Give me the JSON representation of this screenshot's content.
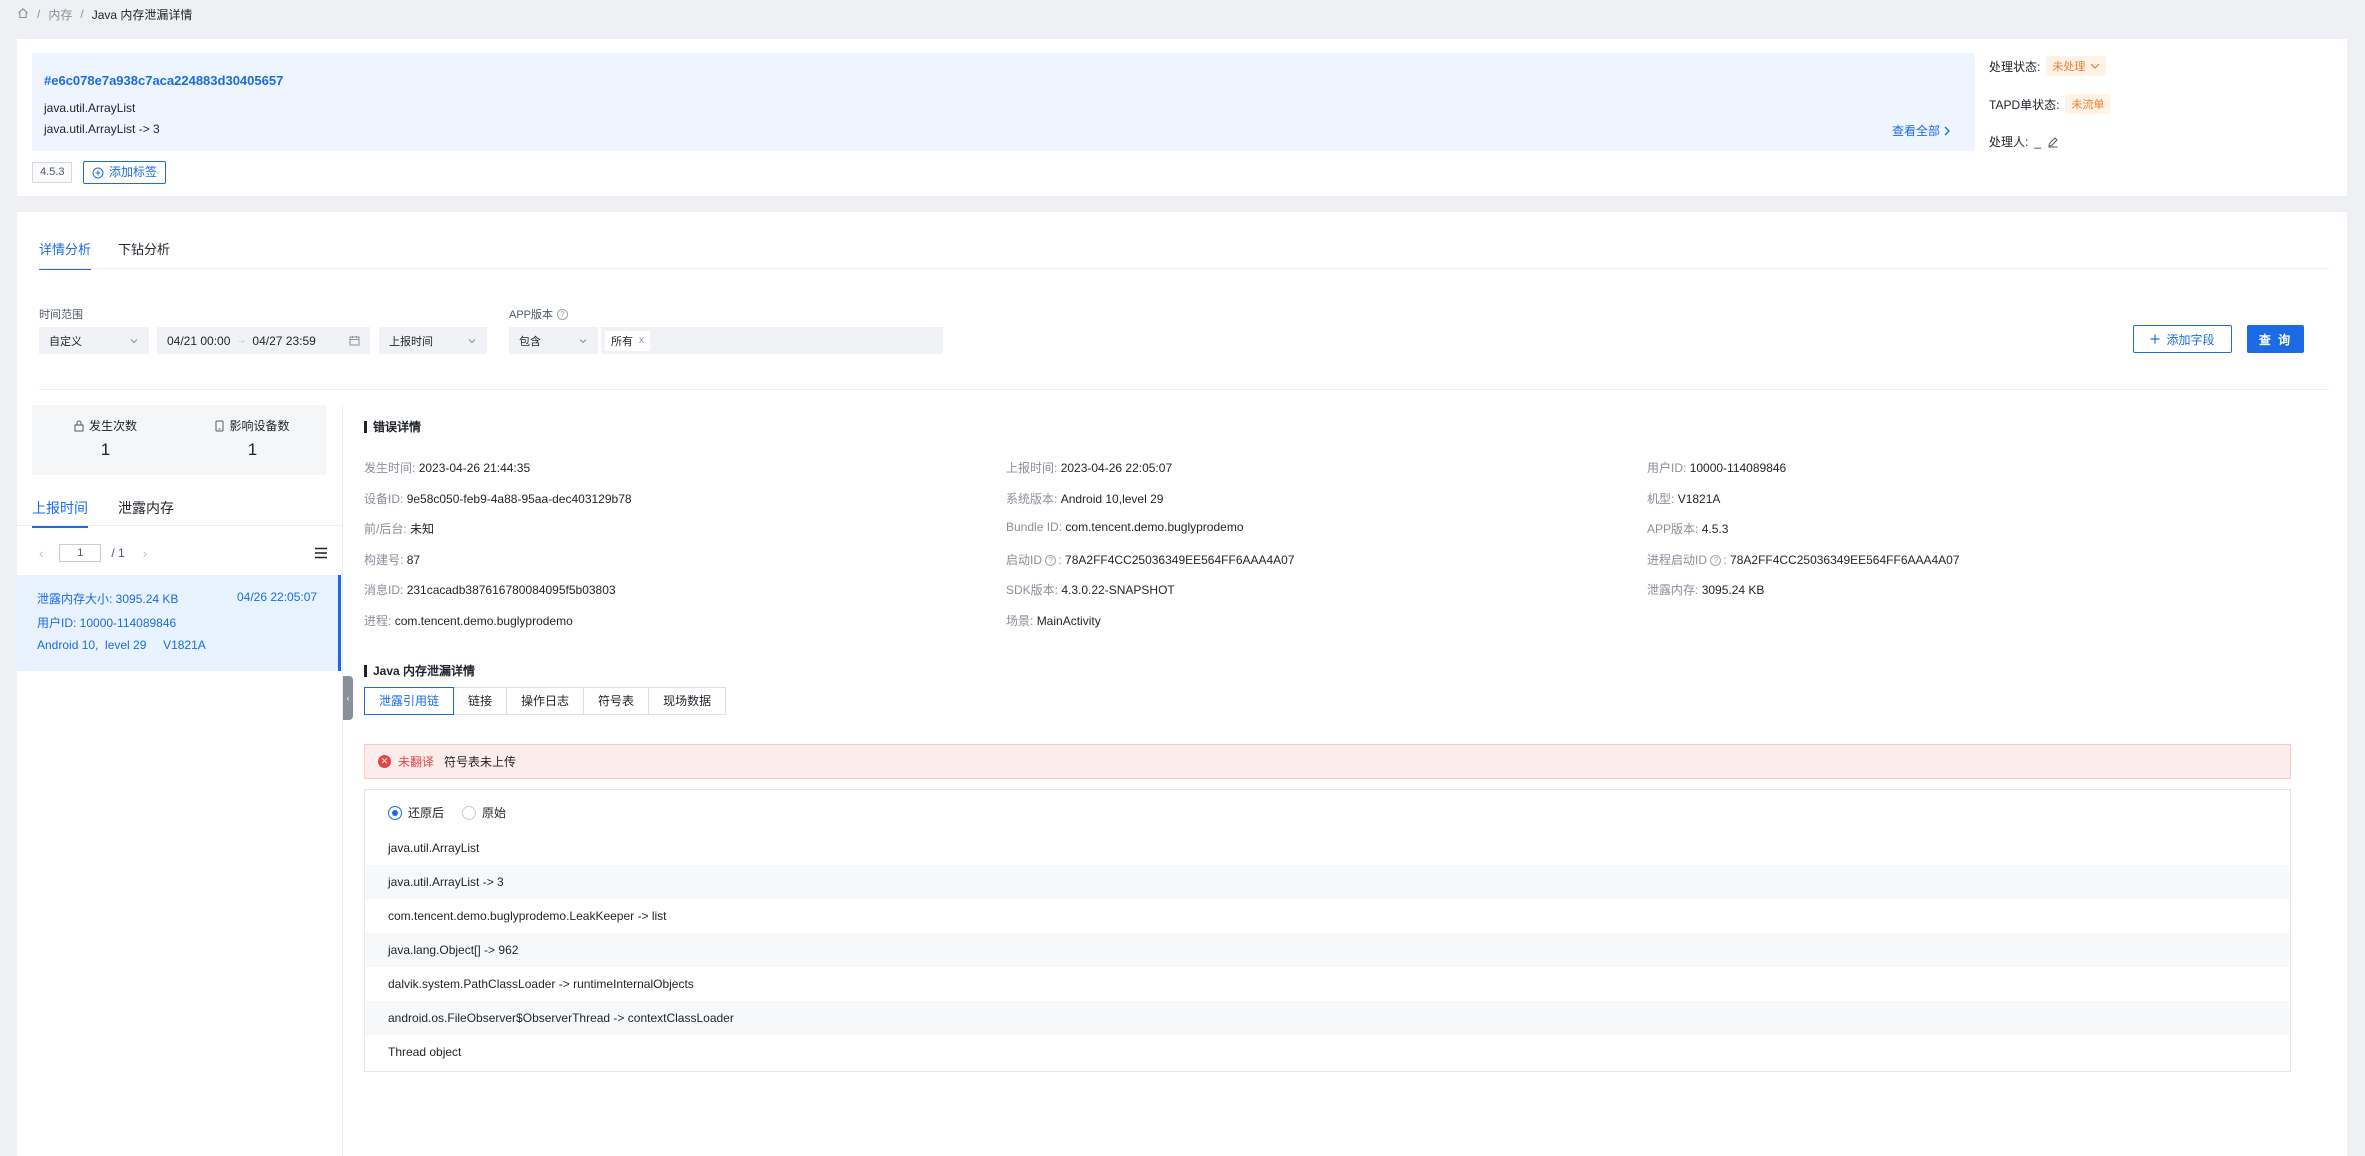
{
  "breadcrumb": {
    "items": [
      "内存",
      "Java 内存泄漏详情"
    ]
  },
  "issue": {
    "hash": "#e6c078e7a938c7aca224883d30405657",
    "line1": "java.util.ArrayList",
    "line2": "java.util.ArrayList -> 3",
    "view_all": "查看全部",
    "version_tag": "4.5.3",
    "add_tag": "添加标签"
  },
  "status": {
    "process_label": "处理状态:",
    "process_value": "未处理",
    "tapd_label": "TAPD单状态:",
    "tapd_value": "未流单",
    "handler_label": "处理人:",
    "handler_value": "_"
  },
  "tabs": {
    "detail": "详情分析",
    "drill": "下钻分析"
  },
  "filters": {
    "time_range_label": "时间范围",
    "time_mode": "自定义",
    "date_start": "04/21 00:00",
    "date_sep": "→",
    "date_end": "04/27 23:59",
    "time_field": "上报时间",
    "app_version_label": "APP版本",
    "include": "包含",
    "version_chip": "所有",
    "add_field": "添加字段",
    "query": "查 询"
  },
  "stats": {
    "occurrences_label": "发生次数",
    "occurrences": "1",
    "devices_label": "影响设备数",
    "devices": "1"
  },
  "left_tabs": {
    "time": "上报时间",
    "mem": "泄露内存"
  },
  "pager": {
    "page": "1",
    "total": "/ 1"
  },
  "list_item": {
    "size": "泄露内存大小:  3095.24 KB",
    "time": "04/26 22:05:07",
    "user": "用户ID:  10000-114089846",
    "device": "Android 10,  level 29     V1821A"
  },
  "error_detail": {
    "title": "错误详情",
    "fields": [
      {
        "k": "发生时间:",
        "v": "2023-04-26 21:44:35"
      },
      {
        "k": "上报时间:",
        "v": "2023-04-26 22:05:07"
      },
      {
        "k": "用户ID:",
        "v": "10000-114089846"
      },
      {
        "k": "设备ID:",
        "v": "9e58c050-feb9-4a88-95aa-dec403129b78"
      },
      {
        "k": "系统版本:",
        "v": "Android 10,level 29"
      },
      {
        "k": "机型:",
        "v": "V1821A"
      },
      {
        "k": "前/后台:",
        "v": "未知"
      },
      {
        "k": "Bundle ID:",
        "v": "com.tencent.demo.buglyprodemo"
      },
      {
        "k": "APP版本:",
        "v": "4.5.3"
      },
      {
        "k": "构建号:",
        "v": "87"
      },
      {
        "k": "启动ID",
        "v": "78A2FF4CC25036349EE564FF6AAA4A07"
      },
      {
        "k": "进程启动ID",
        "v": "78A2FF4CC25036349EE564FF6AAA4A07"
      },
      {
        "k": "消息ID:",
        "v": "231cacadb387616780084095f5b03803"
      },
      {
        "k": "SDK版本:",
        "v": "4.3.0.22-SNAPSHOT"
      },
      {
        "k": "泄露内存:",
        "v": "3095.24 KB"
      },
      {
        "k": "进程:",
        "v": "com.tencent.demo.buglyprodemo"
      },
      {
        "k": "场景:",
        "v": "MainActivity"
      }
    ]
  },
  "leak_detail": {
    "title": "Java 内存泄漏详情",
    "tabs": [
      "泄露引用链",
      "链接",
      "操作日志",
      "符号表",
      "现场数据"
    ],
    "alert_tag": "未翻译",
    "alert_msg": "符号表未上传",
    "radio_restored": "还原后",
    "radio_raw": "原始",
    "trace": [
      "java.util.ArrayList",
      "java.util.ArrayList -> 3",
      "com.tencent.demo.buglyprodemo.LeakKeeper -> list",
      "java.lang.Object[] -> 962",
      "dalvik.system.PathClassLoader -> runtimeInternalObjects",
      "android.os.FileObserver$ObserverThread -> contextClassLoader",
      "Thread object"
    ]
  },
  "colors": {
    "accent": "#1b6be6",
    "warning": "#f57b29",
    "error": "#e54545"
  }
}
